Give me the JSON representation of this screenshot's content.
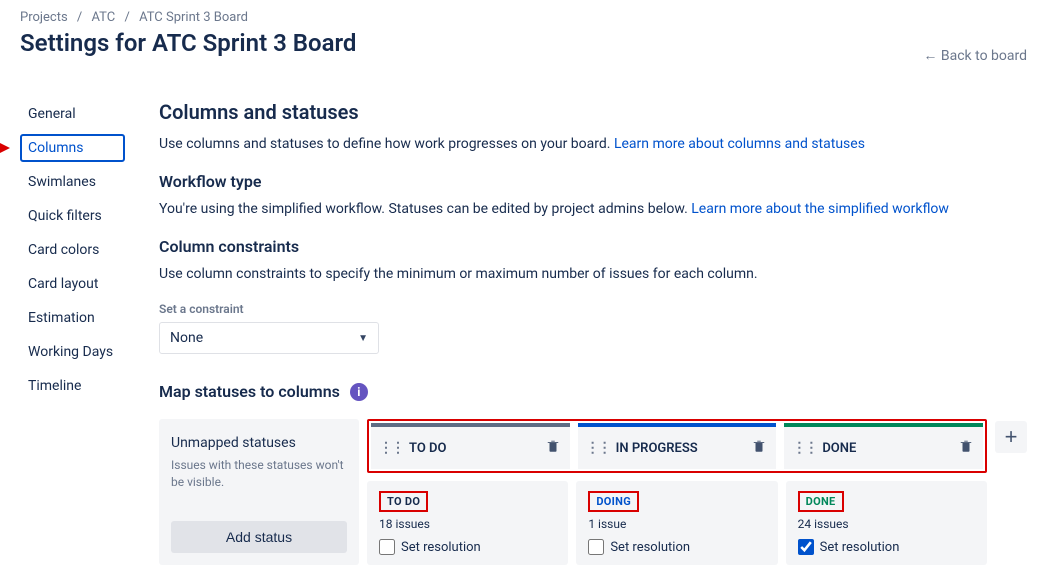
{
  "breadcrumb": {
    "items": [
      "Projects",
      "ATC",
      "ATC Sprint 3 Board"
    ]
  },
  "header": {
    "title": "Settings for ATC Sprint 3 Board",
    "back_link": "← Back to board"
  },
  "sidebar": {
    "items": [
      {
        "label": "General"
      },
      {
        "label": "Columns"
      },
      {
        "label": "Swimlanes"
      },
      {
        "label": "Quick filters"
      },
      {
        "label": "Card colors"
      },
      {
        "label": "Card layout"
      },
      {
        "label": "Estimation"
      },
      {
        "label": "Working Days"
      },
      {
        "label": "Timeline"
      }
    ],
    "active_index": 1
  },
  "main": {
    "section1": {
      "title": "Columns and statuses",
      "desc": "Use columns and statuses to define how work progresses on your board.",
      "link": "Learn more about columns and statuses"
    },
    "workflow": {
      "title": "Workflow type",
      "desc": "You're using the simplified workflow. Statuses can be edited by project admins below.",
      "link": "Learn more about the simplified workflow"
    },
    "constraints": {
      "title": "Column constraints",
      "desc": "Use column constraints to specify the minimum or maximum number of issues for each column.",
      "select_label": "Set a constraint",
      "select_value": "None"
    },
    "map": {
      "title": "Map statuses to columns"
    },
    "unmapped": {
      "title": "Unmapped statuses",
      "sub": "Issues with these statuses won't be visible.",
      "add_label": "Add status"
    },
    "columns": [
      {
        "header": "TO DO",
        "accent": "todo",
        "status_badge": "TO DO",
        "badge_class": "todo-b",
        "issue_count": "18 issues",
        "resolution_label": "Set resolution",
        "resolution_checked": false
      },
      {
        "header": "IN PROGRESS",
        "accent": "inprogress",
        "status_badge": "DOING",
        "badge_class": "doing-b",
        "issue_count": "1 issue",
        "resolution_label": "Set resolution",
        "resolution_checked": false
      },
      {
        "header": "DONE",
        "accent": "done",
        "status_badge": "DONE",
        "badge_class": "done-b",
        "issue_count": "24 issues",
        "resolution_label": "Set resolution",
        "resolution_checked": true
      }
    ]
  }
}
